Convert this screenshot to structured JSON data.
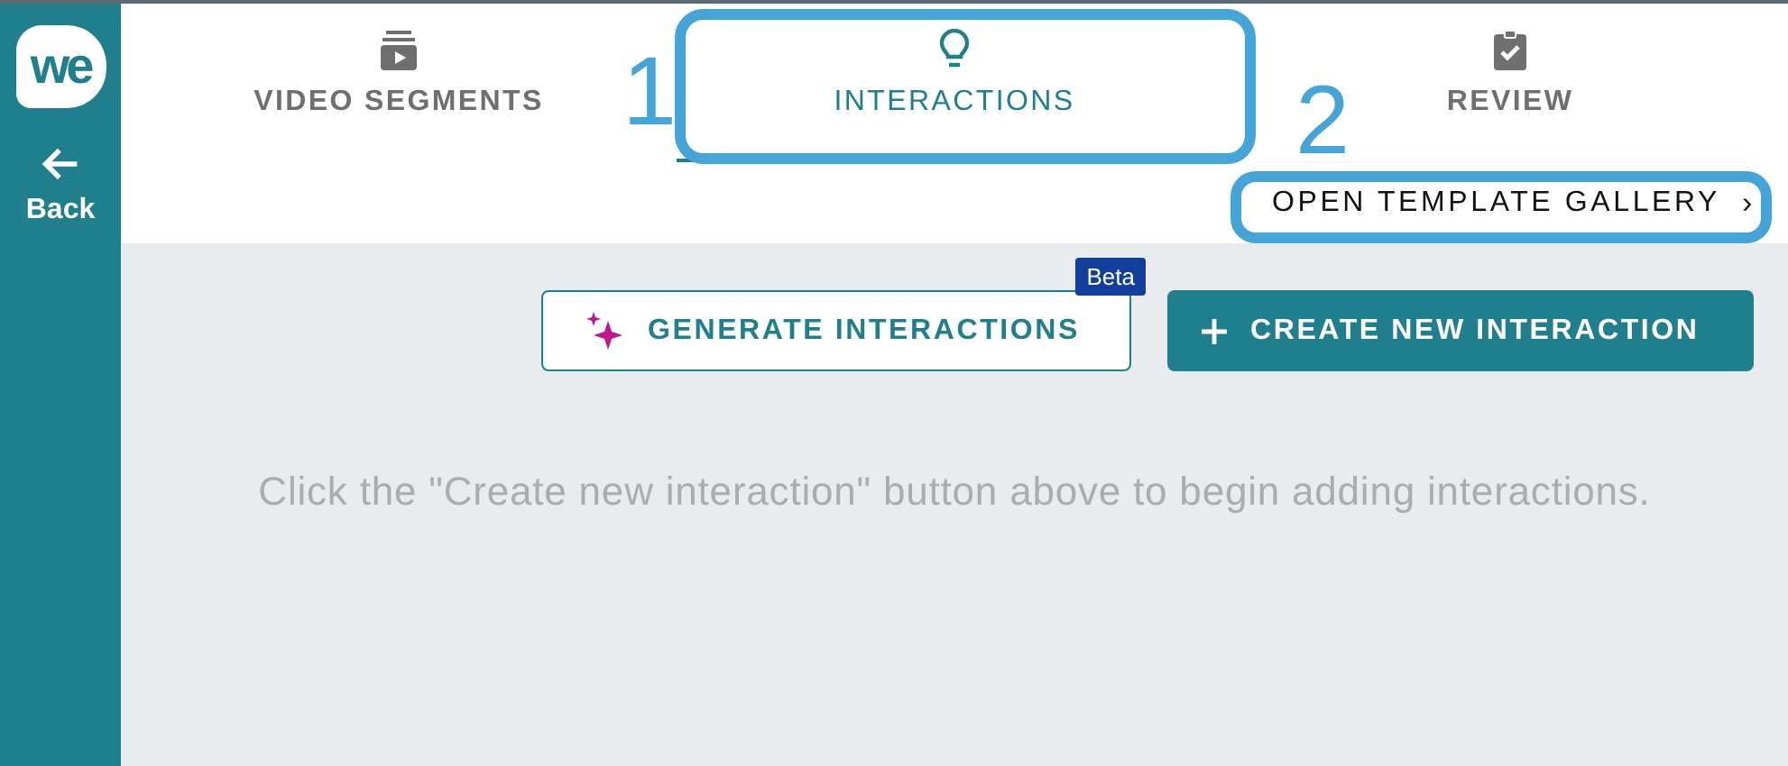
{
  "sidebar": {
    "logo": "we",
    "back": {
      "label": "Back"
    }
  },
  "tabs": [
    {
      "label": "VIDEO SEGMENTS",
      "kind": "video",
      "selected": false
    },
    {
      "label": "INTERACTIONS",
      "kind": "bulb",
      "selected": true
    },
    {
      "label": "REVIEW",
      "kind": "clipboard",
      "selected": false
    }
  ],
  "gallery_link": {
    "label": "OPEN TEMPLATE GALLERY",
    "chevron": "›"
  },
  "actions": [
    {
      "label": "GENERATE INTERACTIONS",
      "kind": "outline",
      "badge": "Beta"
    },
    {
      "label": "CREATE NEW INTERACTION",
      "kind": "filled"
    }
  ],
  "empty_message": "Click the \"Create new interaction\" button above to begin adding interactions.",
  "tab_callout": {
    "number": "1"
  },
  "gallery_callout": {
    "number": "2"
  }
}
